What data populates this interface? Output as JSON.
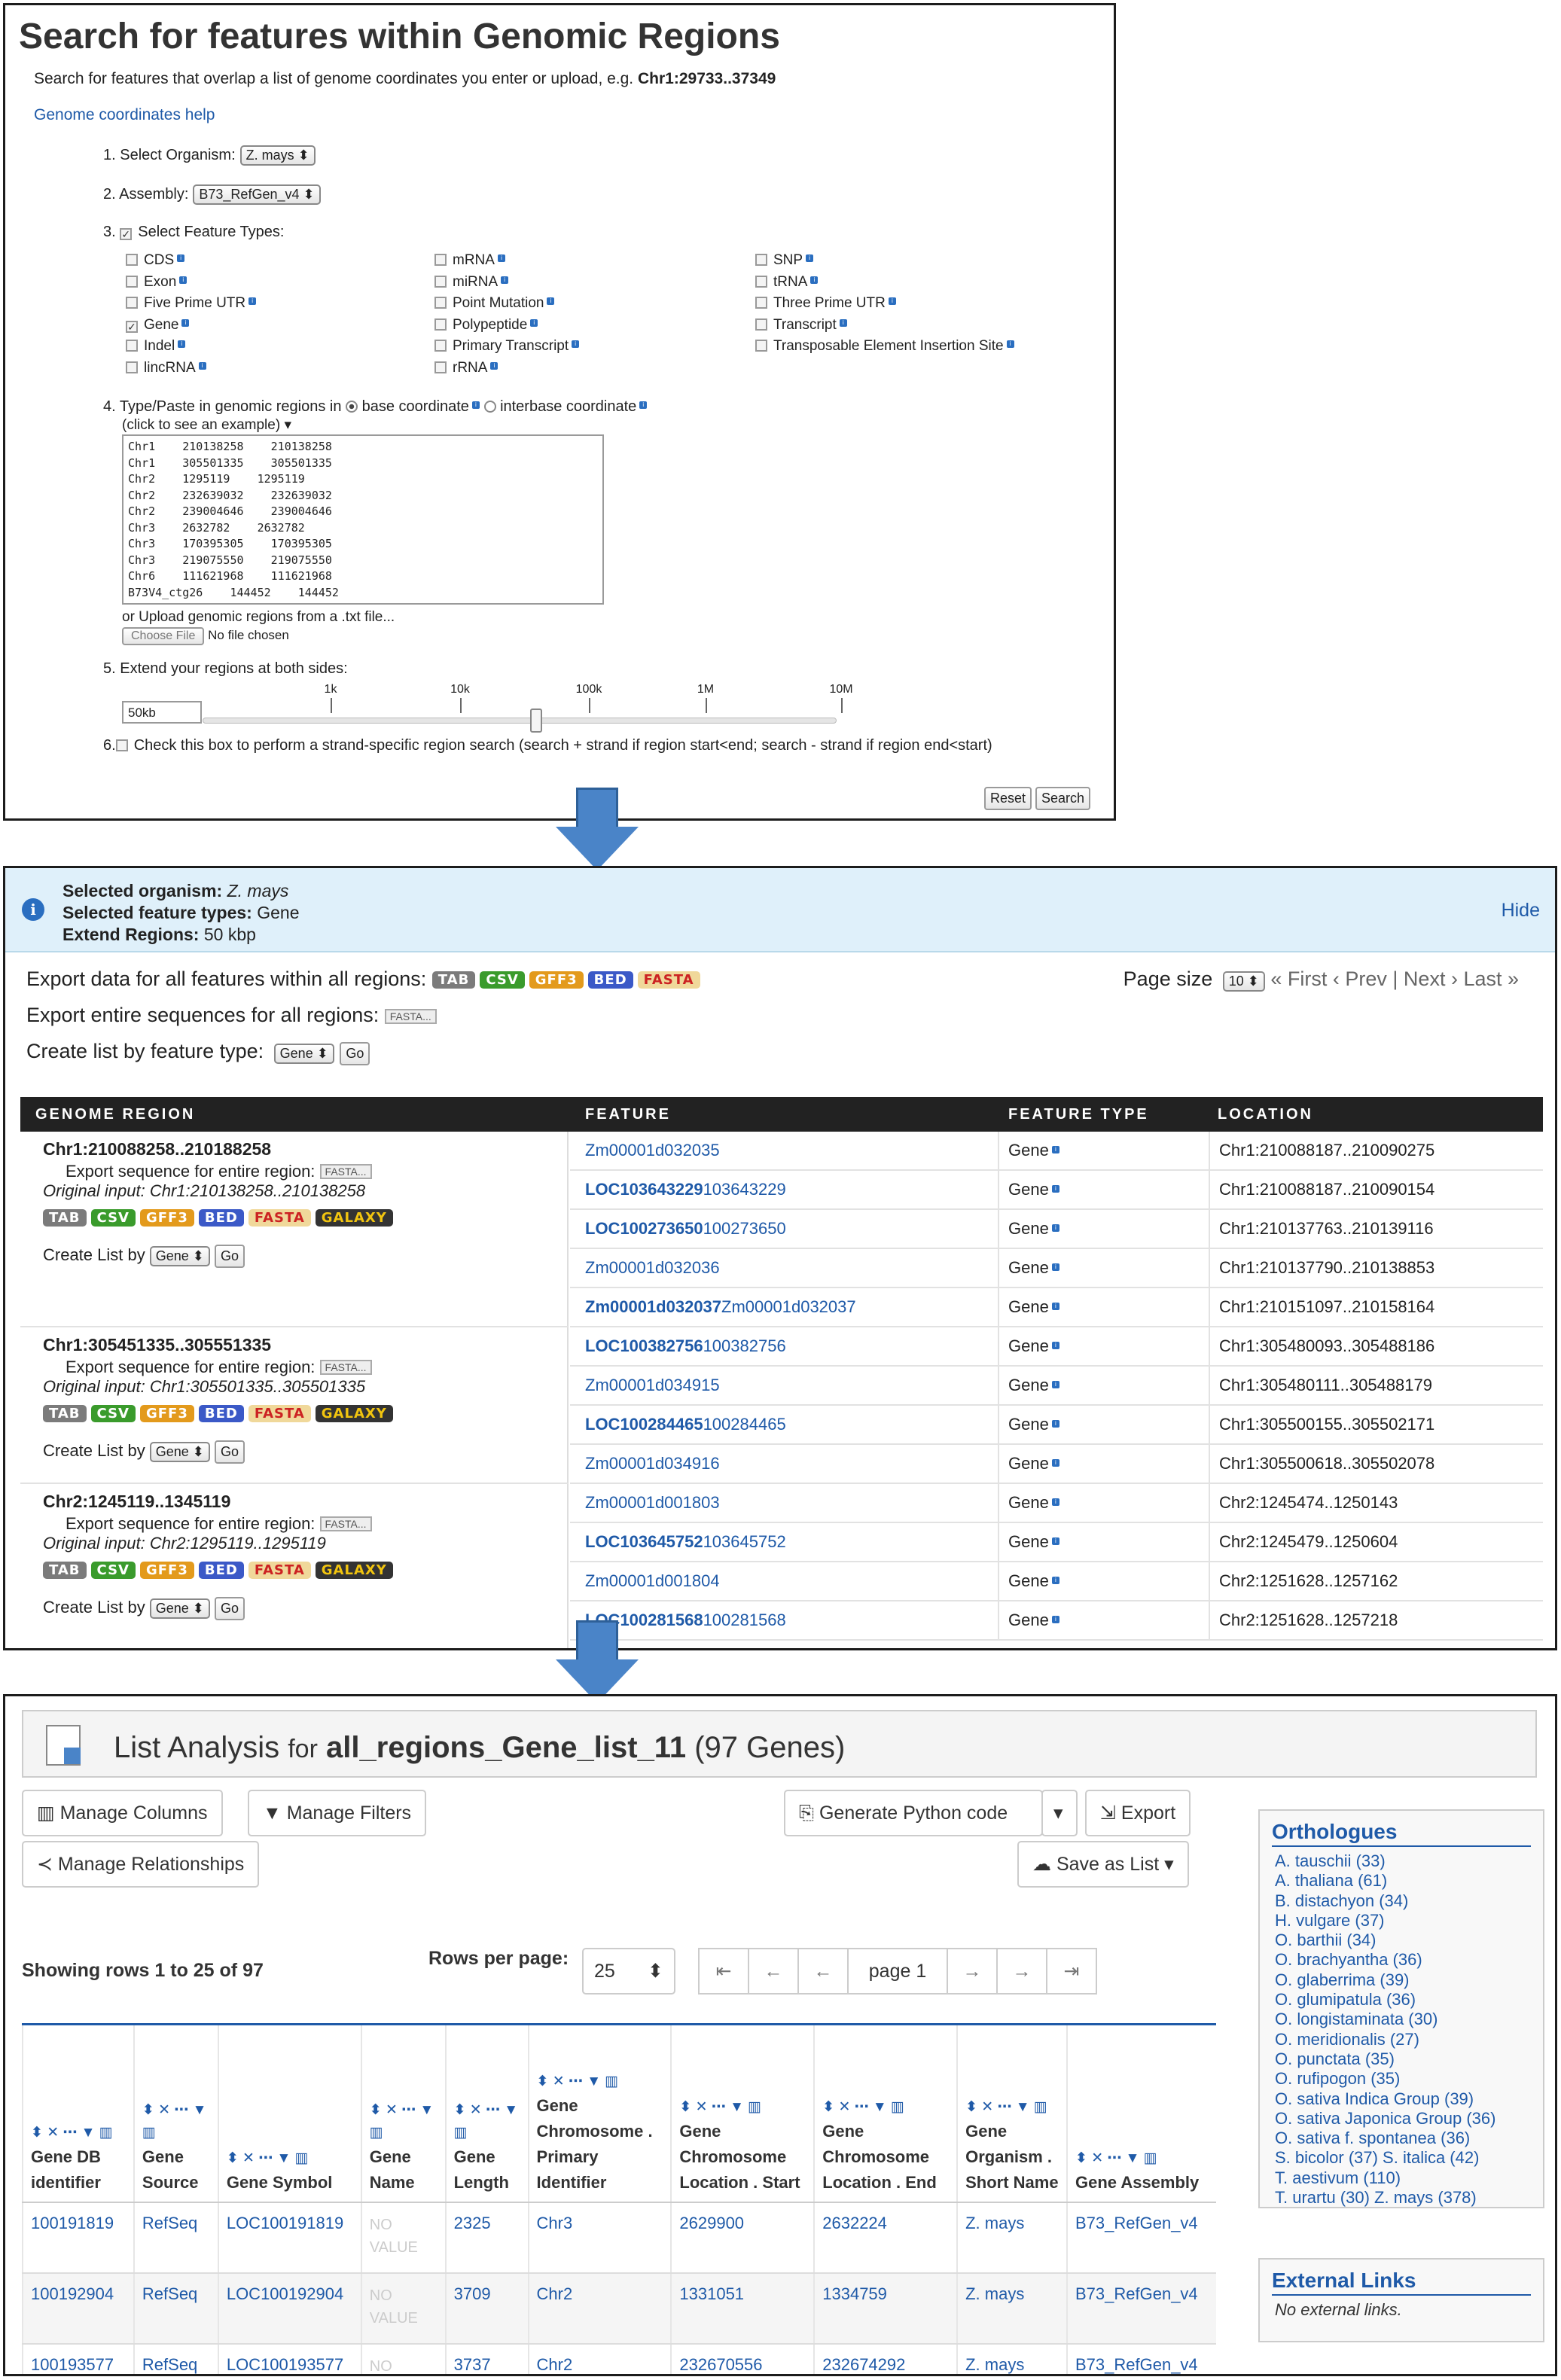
{
  "search": {
    "title": "Search for features within Genomic Regions",
    "subtitle_text": "Search for features that overlap a list of genome coordinates you enter or upload, e.g.",
    "subtitle_example": "Chr1:29733..37349",
    "help_link": "Genome coordinates help",
    "step1_label": "1. Select Organism:",
    "organism": "Z. mays",
    "step2_label": "2. Assembly:",
    "assembly": "B73_RefGen_v4",
    "step3_label": "3.",
    "step3_text": "Select Feature Types:",
    "feature_types": [
      {
        "label": "CDS",
        "checked": false
      },
      {
        "label": "Exon",
        "checked": false
      },
      {
        "label": "Five Prime UTR",
        "checked": false
      },
      {
        "label": "Gene",
        "checked": true
      },
      {
        "label": "Indel",
        "checked": false
      },
      {
        "label": "lincRNA",
        "checked": false
      },
      {
        "label": "mRNA",
        "checked": false
      },
      {
        "label": "miRNA",
        "checked": false
      },
      {
        "label": "Point Mutation",
        "checked": false
      },
      {
        "label": "Polypeptide",
        "checked": false
      },
      {
        "label": "Primary Transcript",
        "checked": false
      },
      {
        "label": "rRNA",
        "checked": false
      },
      {
        "label": "SNP",
        "checked": false
      },
      {
        "label": "tRNA",
        "checked": false
      },
      {
        "label": "Three Prime UTR",
        "checked": false
      },
      {
        "label": "Transcript",
        "checked": false
      },
      {
        "label": "Transposable Element Insertion Site",
        "checked": false
      }
    ],
    "step4_label": "4. Type/Paste in genomic regions in",
    "base_coord": "base coordinate",
    "interbase_coord": "interbase coordinate",
    "example_link": "(click to see an example)",
    "regions": [
      "Chr1\t210138258\t210138258",
      "Chr1\t305501335\t305501335",
      "Chr2\t1295119\t1295119",
      "Chr2\t232639032\t232639032",
      "Chr2\t239004646\t239004646",
      "Chr3\t2632782\t2632782",
      "Chr3\t170395305\t170395305",
      "Chr3\t219075550\t219075550",
      "Chr6\t111621968\t111621968",
      "B73V4_ctg26\t144452\t144452"
    ],
    "upload_label": "or Upload genomic regions from a .txt file...",
    "choose_file": "Choose File",
    "no_file": "No file chosen",
    "step5_label": "5. Extend your regions at both sides:",
    "extend_value": "50kb",
    "slider_ticks": [
      "1k",
      "10k",
      "100k",
      "1M",
      "10M"
    ],
    "slider_position": 0.52,
    "step6_label": "6.",
    "step6_text": "Check this box to perform a strand-specific region search (search + strand if region start<end; search - strand if region end<start)",
    "reset": "Reset",
    "search": "Search"
  },
  "results": {
    "sel_org_label": "Selected organism:",
    "sel_org": "Z. mays",
    "sel_ft_label": "Selected feature types:",
    "sel_ft": "Gene",
    "ext_label": "Extend Regions:",
    "ext": "50 kbp",
    "hide": "Hide",
    "export_all_label": "Export data for all features within all regions:",
    "export_seq_label": "Export entire sequences for all regions:",
    "create_list_label": "Create list by feature type:",
    "list_type": "Gene",
    "go": "Go",
    "page_size_label": "Page size",
    "page_size": "10",
    "pager": "« First ‹ Prev | Next › Last »",
    "formats": [
      "TAB",
      "CSV",
      "GFF3",
      "BED",
      "FASTA"
    ],
    "region_formats": [
      "TAB",
      "CSV",
      "GFF3",
      "BED",
      "FASTA",
      "GALAXY"
    ],
    "fasta_small": "FASTA...",
    "columns": [
      "GENOME REGION",
      "FEATURE",
      "FEATURE TYPE",
      "LOCATION"
    ],
    "region_export_label": "Export sequence for entire region:",
    "create_list_by": "Create List by",
    "regions": [
      {
        "region": "Chr1:210088258..210188258",
        "original": "Original input: Chr1:210138258..210138258"
      },
      {
        "region": "Chr1:305451335..305551335",
        "original": "Original input: Chr1:305501335..305501335"
      },
      {
        "region": "Chr2:1245119..1345119",
        "original": "Original input: Chr2:1295119..1295119"
      }
    ],
    "rows": [
      {
        "id": "Zm00001d032035",
        "sym": "",
        "type": "Gene",
        "loc": "Chr1:210088187..210090275"
      },
      {
        "id": "LOC103643229",
        "sym": "103643229",
        "type": "Gene",
        "loc": "Chr1:210088187..210090154"
      },
      {
        "id": "LOC100273650",
        "sym": "100273650",
        "type": "Gene",
        "loc": "Chr1:210137763..210139116"
      },
      {
        "id": "Zm00001d032036",
        "sym": "",
        "type": "Gene",
        "loc": "Chr1:210137790..210138853"
      },
      {
        "id": "Zm00001d032037",
        "sym": "Zm00001d032037",
        "type": "Gene",
        "loc": "Chr1:210151097..210158164"
      },
      {
        "id": "LOC100382756",
        "sym": "100382756",
        "type": "Gene",
        "loc": "Chr1:305480093..305488186"
      },
      {
        "id": "Zm00001d034915",
        "sym": "",
        "type": "Gene",
        "loc": "Chr1:305480111..305488179"
      },
      {
        "id": "LOC100284465",
        "sym": "100284465",
        "type": "Gene",
        "loc": "Chr1:305500155..305502171"
      },
      {
        "id": "Zm00001d034916",
        "sym": "",
        "type": "Gene",
        "loc": "Chr1:305500618..305502078"
      },
      {
        "id": "Zm00001d001803",
        "sym": "",
        "type": "Gene",
        "loc": "Chr2:1245474..1250143"
      },
      {
        "id": "LOC103645752",
        "sym": "103645752",
        "type": "Gene",
        "loc": "Chr2:1245479..1250604"
      },
      {
        "id": "Zm00001d001804",
        "sym": "",
        "type": "Gene",
        "loc": "Chr2:1251628..1257162"
      },
      {
        "id": "LOC100281568",
        "sym": "100281568",
        "type": "Gene",
        "loc": "Chr2:1251628..1257218"
      }
    ]
  },
  "analysis": {
    "title_prefix": "List Analysis",
    "title_for": "for",
    "list_name": "all_regions_Gene_list_11",
    "count": "(97 Genes)",
    "manage_columns": "Manage Columns",
    "manage_filters": "Manage Filters",
    "manage_relationships": "Manage Relationships",
    "generate_python": "Generate Python code",
    "export": "Export",
    "save_as_list": "Save as List",
    "showing": "Showing rows 1 to 25 of 97",
    "rows_per_page_label": "Rows per page:",
    "rows_per_page": "25",
    "page": "page 1",
    "headers": [
      "Gene DB identifier",
      "Gene Source",
      "Gene Symbol",
      "Gene Name",
      "Gene Length",
      "Gene Chromosome . Primary Identifier",
      "Gene Chromosome Location . Start",
      "Gene Chromosome Location . End",
      "Gene Organism . Short Name",
      "Gene Assembly"
    ],
    "rows": [
      [
        "100191819",
        "RefSeq",
        "LOC100191819",
        "NO VALUE",
        "2325",
        "Chr3",
        "2629900",
        "2632224",
        "Z. mays",
        "B73_RefGen_v4"
      ],
      [
        "100192904",
        "RefSeq",
        "LOC100192904",
        "NO VALUE",
        "3709",
        "Chr2",
        "1331051",
        "1334759",
        "Z. mays",
        "B73_RefGen_v4"
      ],
      [
        "100193577",
        "RefSeq",
        "LOC100193577",
        "NO",
        "3737",
        "Chr2",
        "232670556",
        "232674292",
        "Z. mays",
        "B73_RefGen_v4"
      ]
    ],
    "orthologues_title": "Orthologues",
    "orthologues": [
      "A. tauschii (33)",
      "A. thaliana (61)",
      "B. distachyon (34)",
      "H. vulgare (37)",
      "O. barthii (34)",
      "O. brachyantha (36)",
      "O. glaberrima (39)",
      "O. glumipatula (36)",
      "O. longistaminata (30)",
      "O. meridionalis (27)",
      "O. punctata (35)",
      "O. rufipogon (35)",
      "O. sativa Indica Group (39)",
      "O. sativa Japonica Group (36)",
      "O. sativa f. spontanea (36)",
      "S. bicolor (37)  S. italica (42)",
      "T. aestivum (110)",
      "T. urartu (30)  Z. mays (378)"
    ],
    "external_title": "External Links",
    "external_text": "No external links."
  }
}
